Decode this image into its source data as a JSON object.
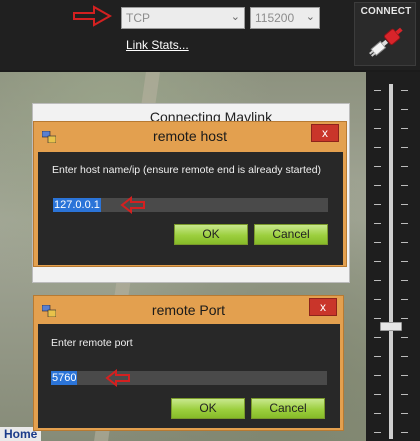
{
  "toolbar": {
    "port_value": "TCP",
    "baud_value": "115200",
    "link_stats_label": "Link Stats...",
    "connect_label": "CONNECT"
  },
  "background_dialog": {
    "title": "Connecting Mavlink"
  },
  "host_dialog": {
    "title": "remote host",
    "close_label": "x",
    "prompt": "Enter host name/ip (ensure remote end is already started)",
    "value": "127.0.0.1",
    "ok_label": "OK",
    "cancel_label": "Cancel"
  },
  "port_dialog": {
    "title": "remote Port",
    "close_label": "x",
    "prompt": "Enter remote port",
    "value": "5760",
    "ok_label": "OK",
    "cancel_label": "Cancel"
  },
  "map": {
    "home_tab_label": "Home"
  },
  "icons": {
    "plug": "plug-icon",
    "app": "app-icon",
    "annotation": "red-arrow-icon"
  },
  "colors": {
    "dialog_frame": "#e3a04f",
    "dialog_body": "#282828",
    "button_green": "#9ccf3e",
    "selection_blue": "#2b74d8",
    "annotation_red": "#d42020"
  }
}
